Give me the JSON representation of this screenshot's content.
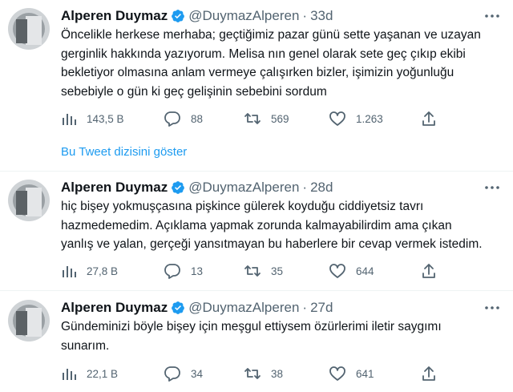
{
  "tweets": [
    {
      "name": "Alperen Duymaz",
      "handle": "@DuymazAlperen",
      "time": "33d",
      "lines": [
        "Öncelikle herkese merhaba; geçtiğimiz pazar günü sette yaşanan ve uzayan",
        "gerginlik hakkında yazıyorum. Melisa nın genel olarak sete geç çıkıp ekibi",
        "bekletiyor olmasına anlam vermeye çalışırken bizler, işimizin yoğunluğu",
        "sebebiyle o gün ki geç gelişinin sebebini sordum"
      ],
      "views": "143,5 B",
      "replies": "88",
      "retweets": "569",
      "likes": "1.263"
    },
    {
      "name": "Alperen Duymaz",
      "handle": "@DuymazAlperen",
      "time": "28d",
      "lines": [
        "hiç bişey yokmuşçasına pişkince gülerek koyduğu ciddiyetsiz tavrı",
        "hazmedemedim. Açıklama yapmak zorunda kalmayabilirdim ama çıkan",
        "yanlış ve yalan, gerçeği yansıtmayan bu haberlere bir cevap vermek istedim."
      ],
      "views": "27,8 B",
      "replies": "13",
      "retweets": "35",
      "likes": "644"
    },
    {
      "name": "Alperen Duymaz",
      "handle": "@DuymazAlperen",
      "time": "27d",
      "lines": [
        "Gündeminizi böyle bişey için meşgul ettiysem özürlerimi iletir saygımı",
        "sunarım."
      ],
      "views": "22,1 B",
      "replies": "34",
      "retweets": "38",
      "likes": "641"
    }
  ],
  "thread_link": "Bu Tweet dizisini göster",
  "colors": {
    "text": "#0f1419",
    "secondary": "#536471",
    "accent": "#1d9bf0",
    "divider": "#eff3f4"
  },
  "icons": [
    "verified-badge-icon",
    "more-icon",
    "views-icon",
    "reply-icon",
    "retweet-icon",
    "like-icon",
    "share-icon"
  ]
}
